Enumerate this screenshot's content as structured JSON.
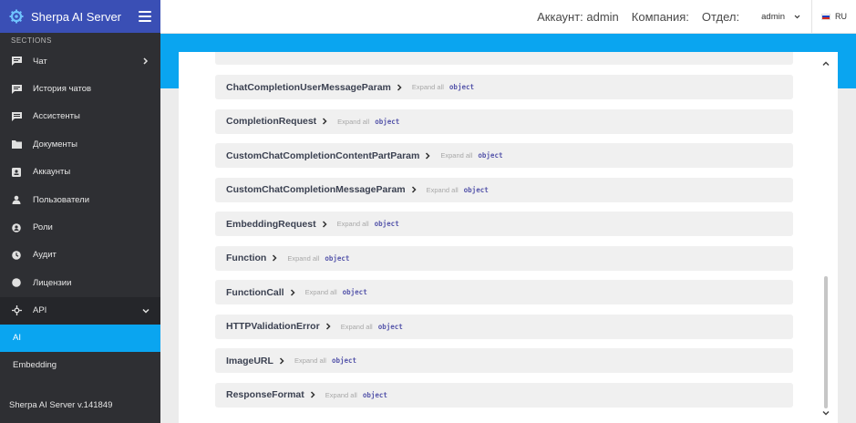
{
  "sidebar": {
    "app_title": "Sherpa AI Server",
    "section_label": "SECTIONS",
    "items": [
      {
        "label": "Чат"
      },
      {
        "label": "История чатов"
      },
      {
        "label": "Ассистенты"
      },
      {
        "label": "Документы"
      },
      {
        "label": "Аккаунты"
      },
      {
        "label": "Пользователи"
      },
      {
        "label": "Роли"
      },
      {
        "label": "Аудит"
      },
      {
        "label": "Лицензии"
      },
      {
        "label": "API"
      }
    ],
    "subitems": [
      {
        "label": "AI",
        "active": true
      },
      {
        "label": "Embedding",
        "active": false
      }
    ],
    "footer": "Sherpa AI Server v.141849"
  },
  "header": {
    "account": "Аккаунт: admin",
    "company": "Компания:",
    "department": "Отдел:",
    "user": "admin",
    "lang": "RU"
  },
  "schemas": {
    "expand_label": "Expand all",
    "type_label": "object",
    "items": [
      {
        "name": "ChatCompletionUserMessageParam"
      },
      {
        "name": "CompletionRequest"
      },
      {
        "name": "CustomChatCompletionContentPartParam"
      },
      {
        "name": "CustomChatCompletionMessageParam"
      },
      {
        "name": "EmbeddingRequest"
      },
      {
        "name": "Function"
      },
      {
        "name": "FunctionCall"
      },
      {
        "name": "HTTPValidationError"
      },
      {
        "name": "ImageURL"
      },
      {
        "name": "ResponseFormat"
      }
    ]
  },
  "colors": {
    "brand": "#3a4fb5",
    "accent": "#0aa5f0",
    "sidebar_bg": "#2e2f33"
  }
}
